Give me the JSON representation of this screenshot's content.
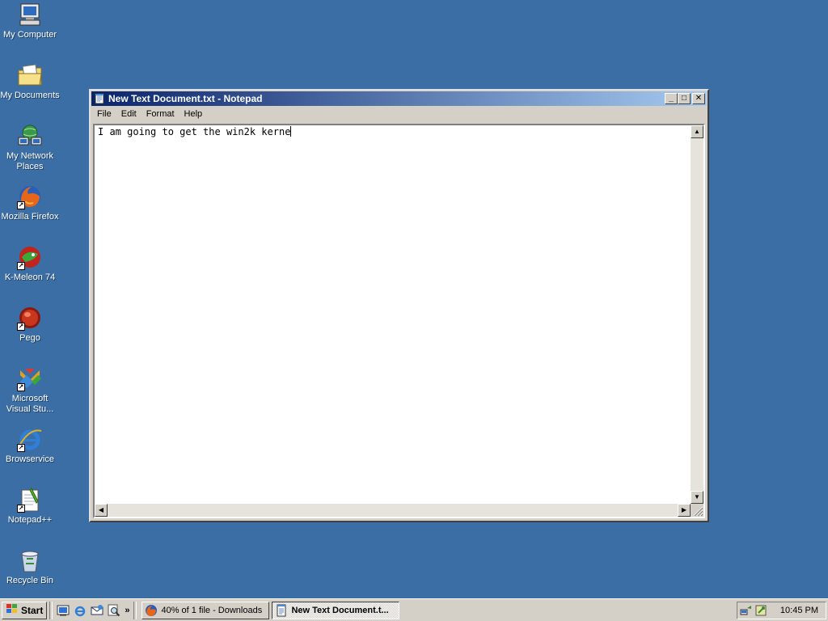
{
  "desktop": {
    "icons": [
      {
        "label": "My Computer",
        "icon": "my-computer-icon"
      },
      {
        "label": "My Documents",
        "icon": "my-documents-icon"
      },
      {
        "label": "My Network Places",
        "icon": "network-places-icon"
      },
      {
        "label": "Mozilla Firefox",
        "icon": "firefox-icon"
      },
      {
        "label": "K-Meleon 74",
        "icon": "k-meleon-icon"
      },
      {
        "label": "Pego",
        "icon": "pego-icon"
      },
      {
        "label": "Microsoft Visual Stu...",
        "icon": "visual-studio-icon"
      },
      {
        "label": "Browservice",
        "icon": "internet-explorer-icon"
      },
      {
        "label": "Notepad++",
        "icon": "notepad-plus-plus-icon"
      },
      {
        "label": "Recycle Bin",
        "icon": "recycle-bin-icon"
      }
    ]
  },
  "window": {
    "title": "New Text Document.txt - Notepad",
    "minimize_label": "_",
    "maximize_label": "□",
    "close_label": "✕",
    "menu": [
      "File",
      "Edit",
      "Format",
      "Help"
    ],
    "content": "I am going to get the win2k kerne"
  },
  "taskbar": {
    "start_label": "Start",
    "quicklaunch": [
      "show-desktop-icon",
      "internet-explorer-icon",
      "outlook-express-icon",
      "search-icon"
    ],
    "more_label": "»",
    "tasks": [
      {
        "label": "40% of 1 file - Downloads",
        "icon": "firefox-icon",
        "active": false
      },
      {
        "label": "New Text Document.t...",
        "icon": "notepad-icon",
        "active": true
      }
    ],
    "clock": "10:45 PM"
  },
  "colors": {
    "desktop": "#3a6ea5",
    "title_gradient_start": "#0a246a",
    "title_gradient_end": "#a6caf0",
    "face": "#d4d0c8"
  }
}
